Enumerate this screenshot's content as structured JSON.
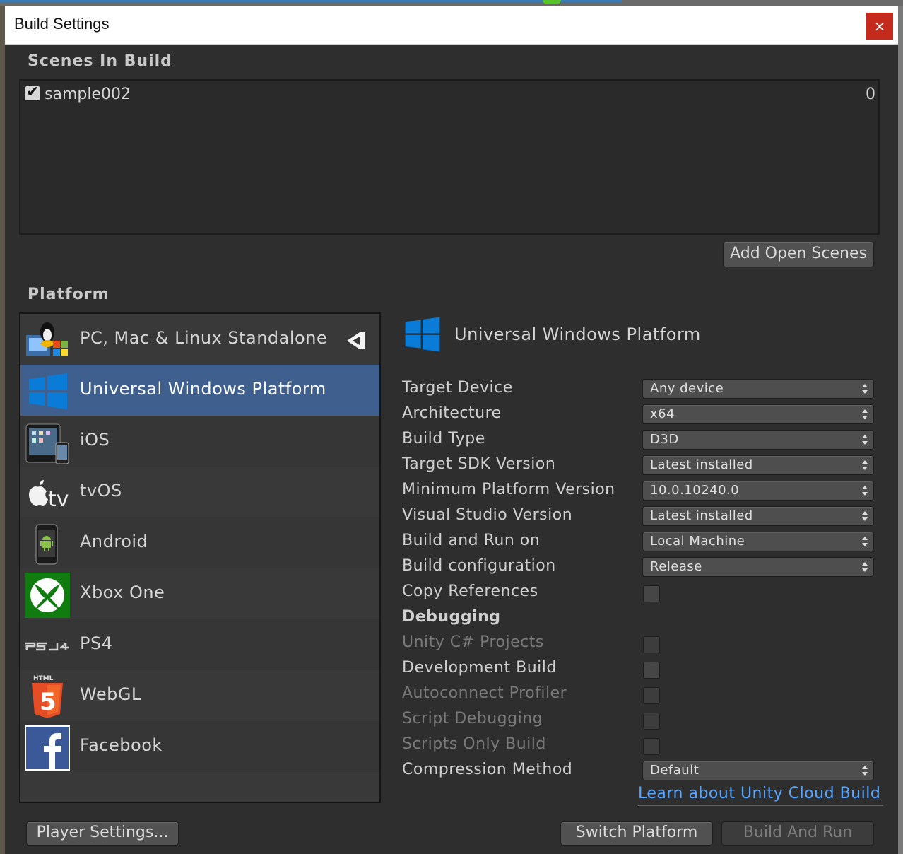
{
  "window": {
    "title": "Build Settings",
    "close_label": "×"
  },
  "scenes": {
    "title": "Scenes In Build",
    "items": [
      {
        "name": "sample002",
        "index": "0",
        "checked": true
      }
    ],
    "add_open_scenes": "Add Open Scenes"
  },
  "platform": {
    "title": "Platform",
    "items": [
      {
        "label": "PC, Mac & Linux Standalone",
        "icon": "standalone-icon",
        "active": true
      },
      {
        "label": "Universal Windows Platform",
        "icon": "windows-icon",
        "selected": true
      },
      {
        "label": "iOS",
        "icon": "ios-icon"
      },
      {
        "label": "tvOS",
        "icon": "appletv-icon"
      },
      {
        "label": "Android",
        "icon": "android-icon"
      },
      {
        "label": "Xbox One",
        "icon": "xbox-icon"
      },
      {
        "label": "PS4",
        "icon": "ps4-icon"
      },
      {
        "label": "WebGL",
        "icon": "html5-icon"
      },
      {
        "label": "Facebook",
        "icon": "facebook-icon"
      }
    ]
  },
  "settings": {
    "header": "Universal Windows Platform",
    "target_device": {
      "label": "Target Device",
      "value": "Any device"
    },
    "architecture": {
      "label": "Architecture",
      "value": "x64"
    },
    "build_type": {
      "label": "Build Type",
      "value": "D3D"
    },
    "target_sdk": {
      "label": "Target SDK Version",
      "value": "Latest installed"
    },
    "min_platform": {
      "label": "Minimum Platform Version",
      "value": "10.0.10240.0"
    },
    "vs_version": {
      "label": "Visual Studio Version",
      "value": "Latest installed"
    },
    "build_run_on": {
      "label": "Build and Run on",
      "value": "Local Machine"
    },
    "build_config": {
      "label": "Build configuration",
      "value": "Release"
    },
    "copy_references": {
      "label": "Copy References",
      "checked": false
    },
    "debugging": "Debugging",
    "unity_csharp": {
      "label": "Unity C# Projects",
      "checked": false,
      "enabled": false
    },
    "development_build": {
      "label": "Development Build",
      "checked": false,
      "enabled": true
    },
    "autoconnect_profiler": {
      "label": "Autoconnect Profiler",
      "checked": false,
      "enabled": false
    },
    "script_debugging": {
      "label": "Script Debugging",
      "checked": false,
      "enabled": false
    },
    "scripts_only": {
      "label": "Scripts Only Build",
      "checked": false,
      "enabled": false
    },
    "compression": {
      "label": "Compression Method",
      "value": "Default"
    },
    "cloud_build_link": "Learn about Unity Cloud Build"
  },
  "footer": {
    "player_settings": "Player Settings...",
    "switch_platform": "Switch Platform",
    "build_and_run": "Build And Run"
  },
  "colors": {
    "window_bg": "#2e2e2e",
    "selection": "#3f5f8f",
    "link": "#59a6ff",
    "close": "#c42b1c"
  }
}
